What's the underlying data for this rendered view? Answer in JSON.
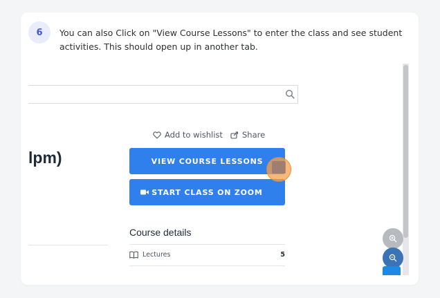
{
  "step": {
    "number": "6",
    "text": "You can also Click on \"View Course Lessons\" to enter the class and see student activities. This should open up in another tab."
  },
  "screenshot": {
    "heading_fragment": "lpm)",
    "wishlist_label": "Add to wishlist",
    "share_label": "Share",
    "view_lessons_label": "VIEW COURSE LESSONS",
    "start_zoom_label": "START CLASS ON ZOOM",
    "course_details_title": "Course details",
    "lectures_label": "Lectures",
    "lectures_count": "5"
  },
  "colors": {
    "accent": "#2f80ed",
    "badge_bg": "#e9ecfb",
    "badge_text": "#4056d6",
    "click_marker": "#f5a04b"
  },
  "icons": [
    "search-icon",
    "heart-icon",
    "share-icon",
    "video-camera-icon",
    "book-icon",
    "zoom-in-icon",
    "zoom-out-icon"
  ]
}
